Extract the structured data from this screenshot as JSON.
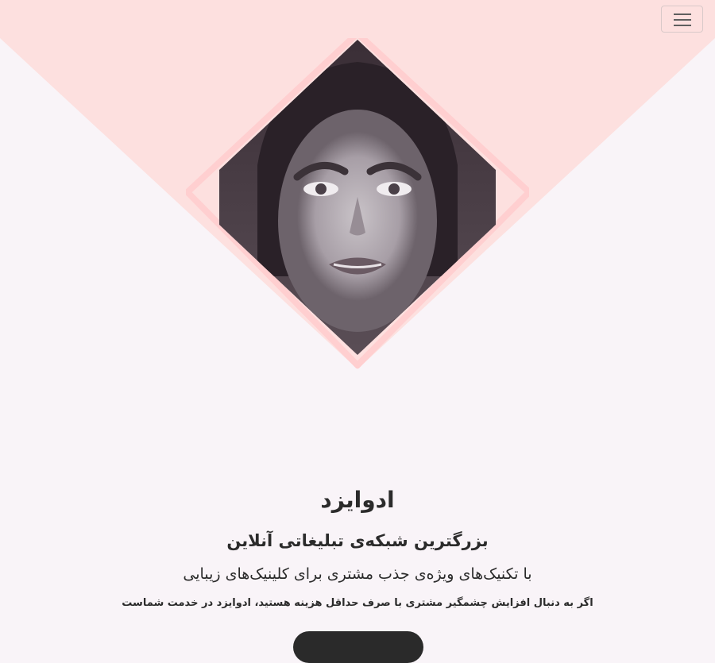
{
  "header": {
    "menu_button_icon": "hamburger-icon"
  },
  "hero": {
    "image": "woman-portrait-diamond",
    "colors": {
      "background": "#f9f4f8",
      "pink_triangle": "#fde0df",
      "diamond_outline": "#ffcfd0",
      "photo_base": "#4a3f46"
    }
  },
  "content": {
    "brand_title": "ادوایزد",
    "headline": "بزرگترین شبکه‌ی تبلیغاتی آنلاین",
    "subheadline": "با تکنیک‌های ویژه‌ی جذب مشتری برای کلینیک‌های زیبایی",
    "description": "اگر به دنبال افزایش چشمگیر مشتری با صرف حداقل هزینه هستید، ادوایزد در خدمت شماست",
    "cta_label": ""
  }
}
